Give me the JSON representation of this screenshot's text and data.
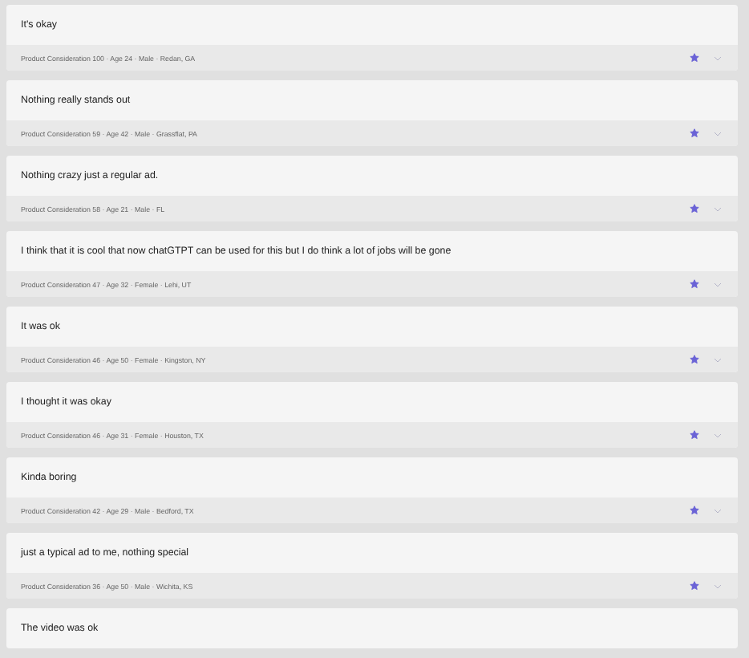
{
  "responses": [
    {
      "text": "It's okay",
      "meta": "Product Consideration 100 · Age 24 · Male · Redan, GA",
      "starred": true
    },
    {
      "text": "Nothing really stands out",
      "meta": "Product Consideration 59 · Age 42 · Male · Grassflat, PA",
      "starred": true
    },
    {
      "text": "Nothing crazy just a regular ad.",
      "meta": "Product Consideration 58 · Age 21 · Male · FL",
      "starred": true
    },
    {
      "text": "I think that it is cool that now chatGTPT can be used for this but I do think a lot of jobs will be gone",
      "meta": "Product Consideration 47 · Age 32 · Female · Lehi, UT",
      "starred": true
    },
    {
      "text": "It was ok",
      "meta": "Product Consideration 46 · Age 50 · Female · Kingston, NY",
      "starred": true
    },
    {
      "text": "I thought it was okay",
      "meta": "Product Consideration 46 · Age 31 · Female · Houston, TX",
      "starred": true
    },
    {
      "text": "Kinda boring",
      "meta": "Product Consideration 42 · Age 29 · Male · Bedford, TX",
      "starred": true
    },
    {
      "text": "just a typical ad to me, nothing special",
      "meta": "Product Consideration 36 · Age 50 · Male · Wichita, KS",
      "starred": true
    },
    {
      "text": "The video was ok"
    }
  ]
}
